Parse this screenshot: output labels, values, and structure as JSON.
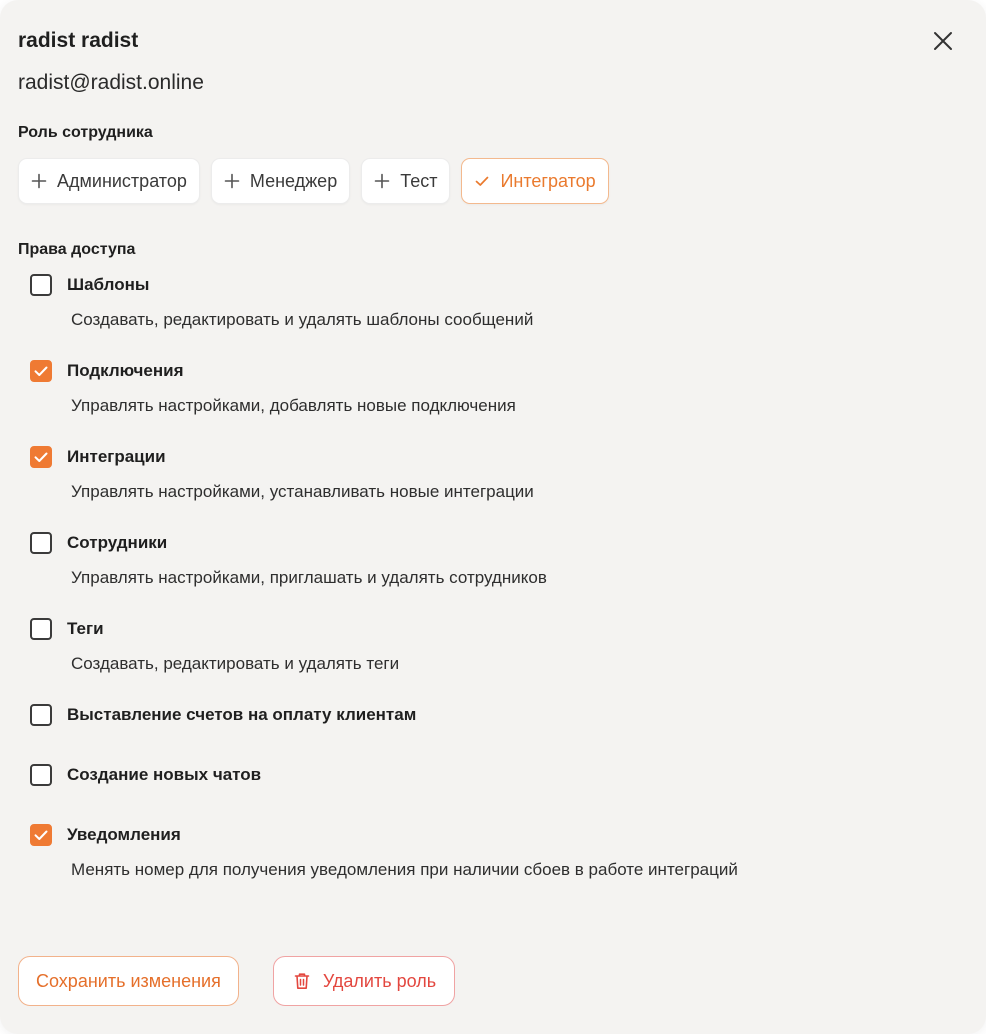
{
  "user": {
    "name": "radist radist",
    "email": "radist@radist.online"
  },
  "roles_section": {
    "title": "Роль сотрудника",
    "items": [
      {
        "label": "Администратор",
        "icon": "plus-icon",
        "active": false
      },
      {
        "label": "Менеджер",
        "icon": "plus-icon",
        "active": false
      },
      {
        "label": "Тест",
        "icon": "plus-icon",
        "active": false
      },
      {
        "label": "Интегратор",
        "icon": "check-icon",
        "active": true
      }
    ]
  },
  "permissions_section": {
    "title": "Права доступа",
    "items": [
      {
        "label": "Шаблоны",
        "description": "Создавать, редактировать и удалять шаблоны сообщений",
        "checked": false
      },
      {
        "label": "Подключения",
        "description": "Управлять настройками, добавлять новые подключения",
        "checked": true
      },
      {
        "label": "Интеграции",
        "description": "Управлять настройками, устанавливать новые интеграции",
        "checked": true
      },
      {
        "label": "Сотрудники",
        "description": "Управлять настройками, приглашать и удалять сотрудников",
        "checked": false
      },
      {
        "label": "Теги",
        "description": "Создавать, редактировать и удалять теги",
        "checked": false
      },
      {
        "label": "Выставление счетов на оплату клиентам",
        "description": "",
        "checked": false
      },
      {
        "label": "Создание новых чатов",
        "description": "",
        "checked": false
      },
      {
        "label": "Уведомления",
        "description": "Менять номер для получения уведомления при наличии сбоев в работе интеграций",
        "checked": true
      }
    ]
  },
  "actions": {
    "save_label": "Сохранить изменения",
    "delete_label": "Удалить роль"
  },
  "colors": {
    "accent": "#ef7a33",
    "danger": "#e3473f",
    "background": "#f4f3f1"
  }
}
